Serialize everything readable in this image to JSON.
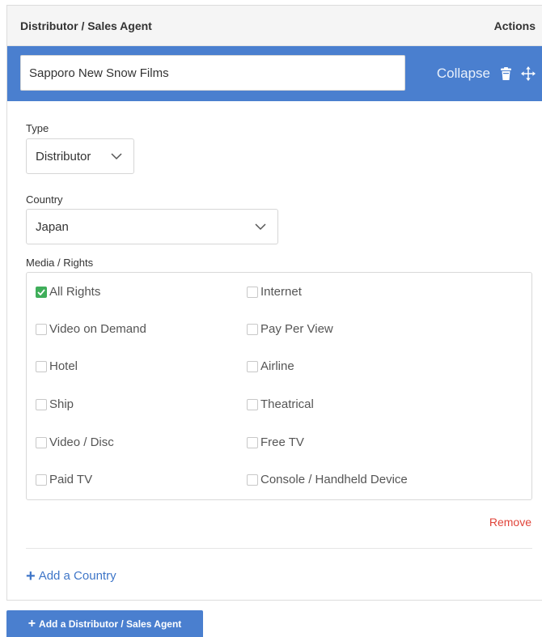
{
  "header": {
    "title": "Distributor / Sales Agent",
    "actions_label": "Actions"
  },
  "entry": {
    "name_value": "Sapporo New Snow Films",
    "collapse_label": "Collapse"
  },
  "type_field": {
    "label": "Type",
    "selected": "Distributor"
  },
  "country_field": {
    "label": "Country",
    "selected": "Japan"
  },
  "rights": {
    "label": "Media / Rights",
    "items": [
      {
        "label": "All Rights",
        "checked": true
      },
      {
        "label": "Internet",
        "checked": false
      },
      {
        "label": "Video on Demand",
        "checked": false
      },
      {
        "label": "Pay Per View",
        "checked": false
      },
      {
        "label": "Hotel",
        "checked": false
      },
      {
        "label": "Airline",
        "checked": false
      },
      {
        "label": "Ship",
        "checked": false
      },
      {
        "label": "Theatrical",
        "checked": false
      },
      {
        "label": "Video / Disc",
        "checked": false
      },
      {
        "label": "Free TV",
        "checked": false
      },
      {
        "label": "Paid TV",
        "checked": false
      },
      {
        "label": "Console / Handheld Device",
        "checked": false
      }
    ]
  },
  "remove_label": "Remove",
  "add_country_label": "Add a Country",
  "add_distributor_label": "Add a Distributor / Sales Agent",
  "colors": {
    "accent_blue": "#4a7fcf",
    "link_blue": "#3f76c8",
    "checked_green": "#3fae5a",
    "remove_red": "#e0443a"
  }
}
